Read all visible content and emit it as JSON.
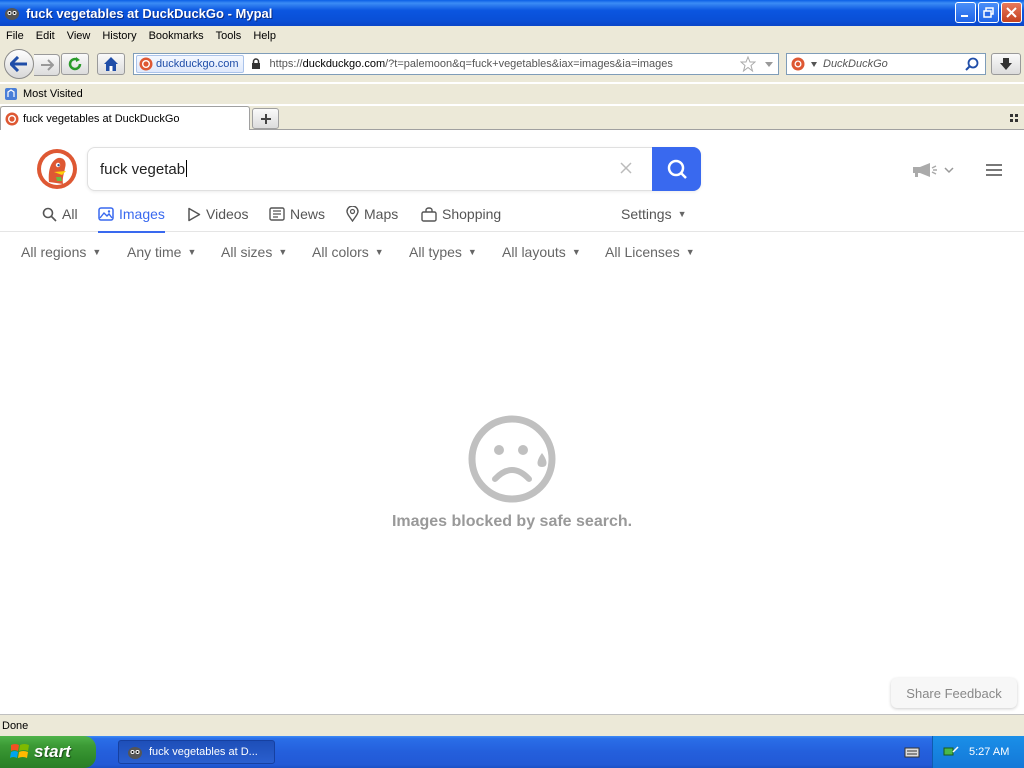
{
  "window": {
    "title": "fuck vegetables at DuckDuckGo - Mypal"
  },
  "menu": [
    "File",
    "Edit",
    "View",
    "History",
    "Bookmarks",
    "Tools",
    "Help"
  ],
  "navbar": {
    "identity_domain": "duckduckgo.com",
    "url_prefix": "https://",
    "url_host": "duckduckgo.com",
    "url_rest": "/?t=palemoon&q=fuck+vegetables&iax=images&ia=images",
    "search_placeholder": "DuckDuckGo"
  },
  "bookmarks": {
    "most_visited": "Most Visited"
  },
  "tabs": [
    {
      "label": "fuck vegetables at DuckDuckGo"
    }
  ],
  "page": {
    "query": "fuck vegetab",
    "nav_tabs": [
      {
        "label": "All",
        "icon": "search-icon"
      },
      {
        "label": "Images",
        "icon": "image-icon",
        "active": true
      },
      {
        "label": "Videos",
        "icon": "play-icon"
      },
      {
        "label": "News",
        "icon": "newspaper-icon"
      },
      {
        "label": "Maps",
        "icon": "map-pin-icon"
      },
      {
        "label": "Shopping",
        "icon": "shopping-bag-icon"
      }
    ],
    "settings": "Settings",
    "filters": [
      "All regions",
      "Any time",
      "All sizes",
      "All colors",
      "All types",
      "All layouts",
      "All Licenses"
    ],
    "blocked_message": "Images blocked by safe search.",
    "feedback": "Share Feedback"
  },
  "status": "Done",
  "taskbar": {
    "start": "start",
    "task_label": "fuck vegetables at D...",
    "clock": "5:27 AM"
  },
  "colors": {
    "accent": "#3969ef",
    "ddg_orange": "#de5833"
  }
}
